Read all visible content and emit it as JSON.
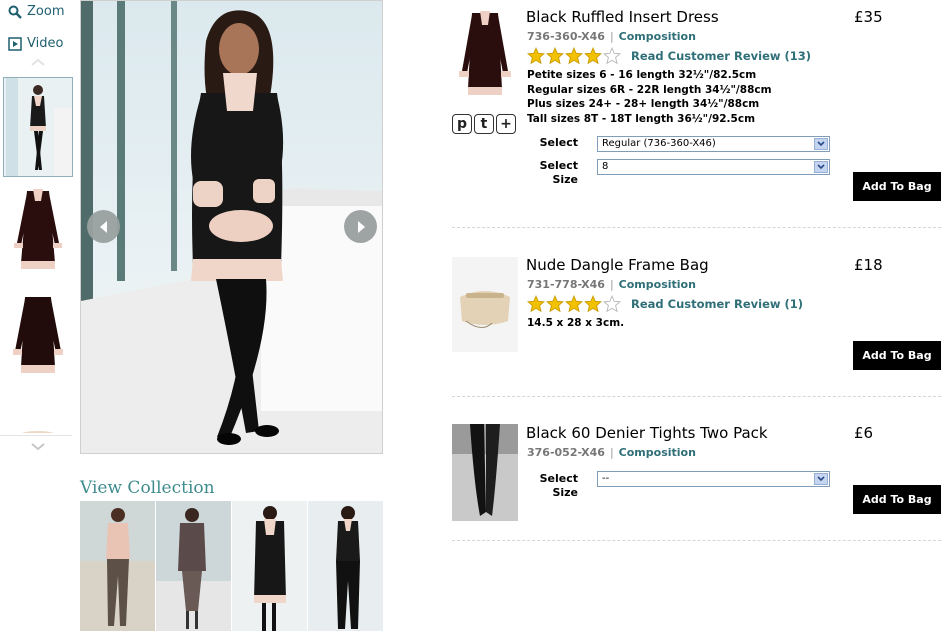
{
  "gallery": {
    "zoom_label": "Zoom",
    "video_label": "Video",
    "view_collection_label": "View Collection"
  },
  "products": [
    {
      "title": "Black Ruffled Insert Dress",
      "price": "£35",
      "code": "736-360-X46",
      "composition_label": "Composition",
      "rating": 4,
      "review_label": "Read Customer Review (13)",
      "sizes_lines": [
        "Petite sizes 6 - 16 length 32½\"/82.5cm",
        "Regular sizes 6R - 22R length 34½\"/88cm",
        "Plus sizes 24+ - 28+ length 34½\"/88cm",
        "Tall sizes 8T - 18T length 36½\"/92.5cm"
      ],
      "social_icons": [
        "p",
        "t",
        "+"
      ],
      "select_label": "Select",
      "select_value": "Regular (736-360-X46)",
      "size_label_line1": "Select",
      "size_label_line2": "Size",
      "size_value": "8",
      "add_to_bag": "Add To Bag"
    },
    {
      "title": "Nude Dangle Frame Bag",
      "price": "£18",
      "code": "731-778-X46",
      "composition_label": "Composition",
      "rating": 4,
      "review_label": "Read Customer Review (1)",
      "desc": "14.5 x 28 x 3cm.",
      "add_to_bag": "Add To Bag"
    },
    {
      "title": "Black 60 Denier Tights Two Pack",
      "price": "£6",
      "code": "376-052-X46",
      "composition_label": "Composition",
      "size_label_line1": "Select",
      "size_label_line2": "Size",
      "size_value": "--",
      "add_to_bag": "Add To Bag"
    }
  ],
  "colors": {
    "accent_teal": "#2f6f78",
    "view_collection": "#3f8b8e",
    "star_gold": "#f2c200",
    "button_black": "#000000"
  },
  "icons": [
    "zoom-icon",
    "video-icon",
    "chevron-up-icon",
    "chevron-down-icon",
    "arrow-left-icon",
    "arrow-right-icon",
    "star-icon",
    "dropdown-arrow-icon"
  ]
}
